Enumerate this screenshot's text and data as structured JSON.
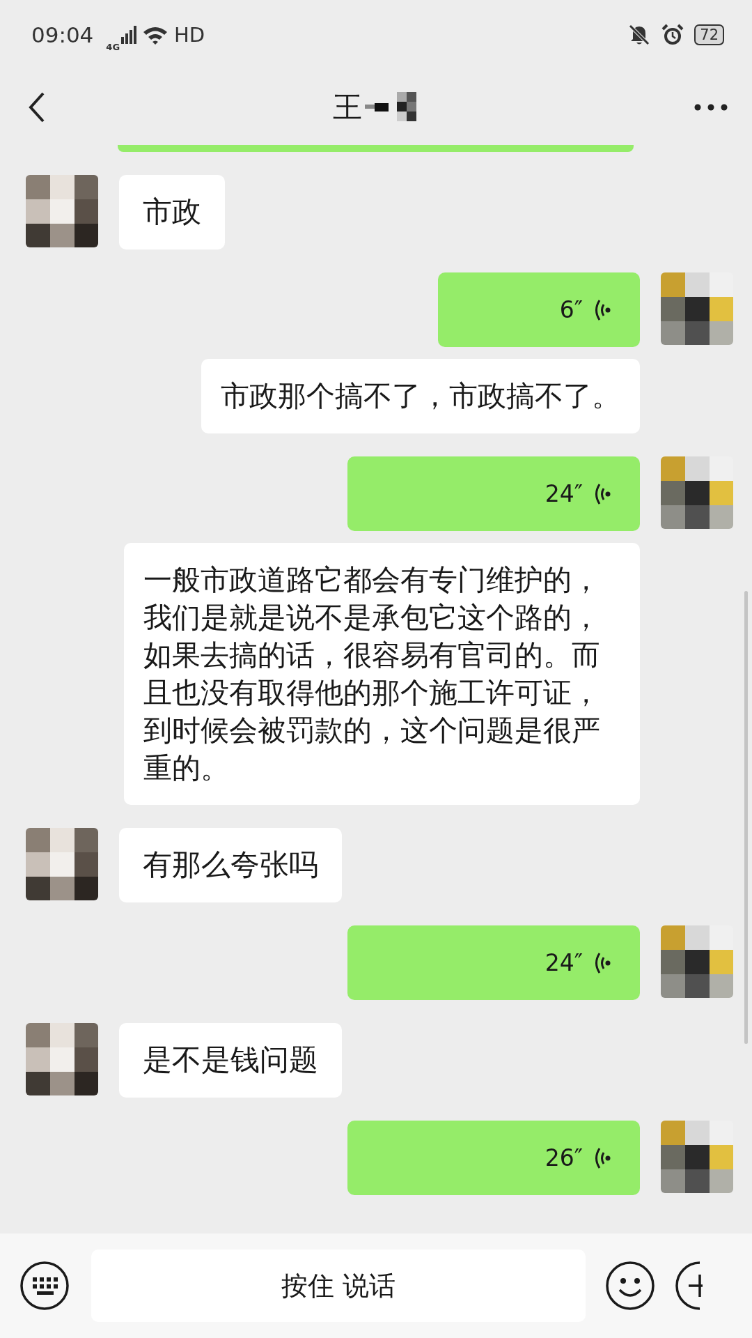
{
  "status_bar": {
    "time": "09:04",
    "network": "4G",
    "hd": "HD",
    "battery": "72"
  },
  "header": {
    "title": "王",
    "title_redacted": true
  },
  "messages": [
    {
      "kind": "clipped",
      "outgoing": true
    },
    {
      "kind": "text",
      "outgoing": false,
      "text": "市政"
    },
    {
      "kind": "voice",
      "outgoing": true,
      "duration": "6″"
    },
    {
      "kind": "transcript",
      "text": "市政那个搞不了，市政搞不了。"
    },
    {
      "kind": "voice",
      "outgoing": true,
      "duration": "24″"
    },
    {
      "kind": "transcript",
      "text": "一般市政道路它都会有专门维护的，我们是就是说不是承包它这个路的，如果去搞的话，很容易有官司的。而且也没有取得他的那个施工许可证，到时候会被罚款的，这个问题是很严重的。"
    },
    {
      "kind": "text",
      "outgoing": false,
      "text": "有那么夸张吗"
    },
    {
      "kind": "voice",
      "outgoing": true,
      "duration": "24″"
    },
    {
      "kind": "text",
      "outgoing": false,
      "text": "是不是钱问题"
    },
    {
      "kind": "voice",
      "outgoing": true,
      "duration": "26″"
    }
  ],
  "input_bar": {
    "hold_to_talk": "按住 说话"
  }
}
